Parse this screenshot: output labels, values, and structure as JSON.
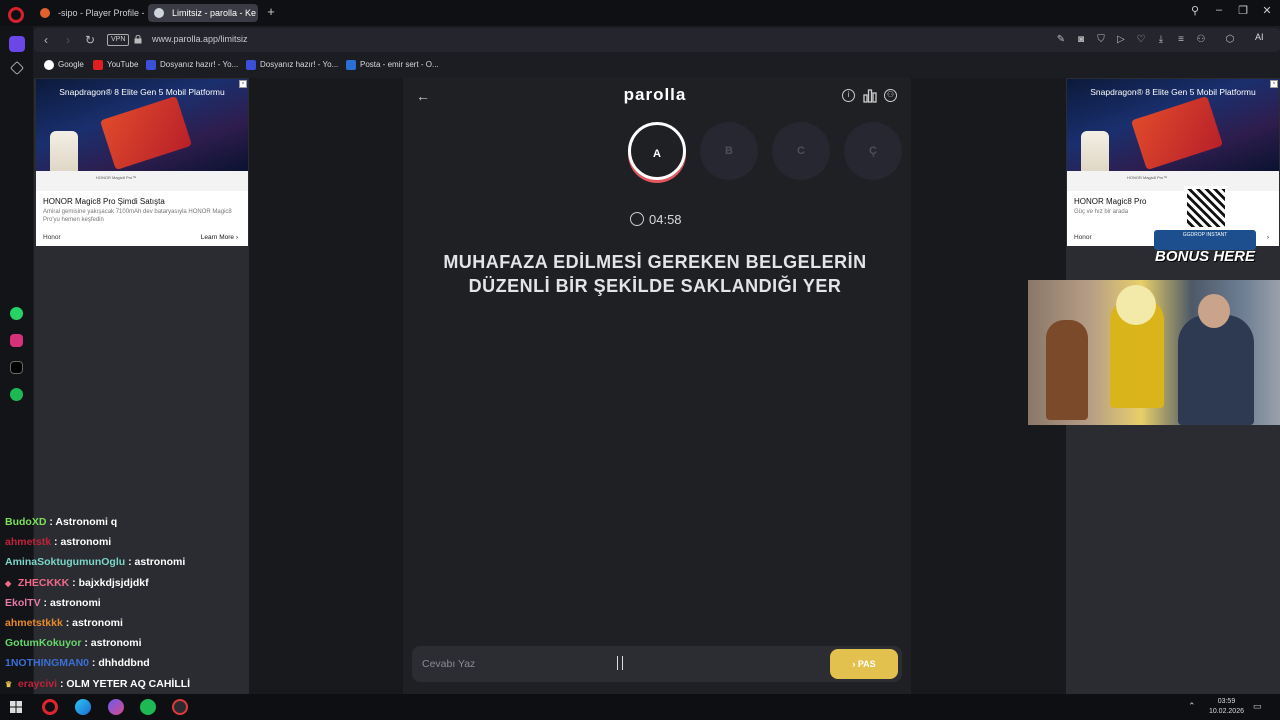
{
  "browser": {
    "tabs": [
      {
        "label": "-sipo - Player Profile - FAC"
      },
      {
        "label": "Limitsiz - parolla - Ke"
      }
    ],
    "vpn_label": "VPN",
    "url": "www.parolla.app/limitsiz",
    "ai_label": "AI",
    "bookmarks": [
      {
        "label": "Google"
      },
      {
        "label": "YouTube"
      },
      {
        "label": "Dosyanız hazır! - Yo..."
      },
      {
        "label": "Dosyanız hazır! - Yo..."
      },
      {
        "label": "Posta - emir sert - O..."
      }
    ]
  },
  "ads": {
    "left": {
      "headline": "Snapdragon® 8 Elite Gen 5 Mobil Platformu",
      "product_strip": "HONOR Magic8 Pro™",
      "title": "HONOR Magic8 Pro Şimdi Satışta",
      "description": "Amiral gemisine yakışacak 7100mAh dev bataryasıyla HONOR Magic8 Pro'yu hemen keşfedin",
      "brand": "Honor",
      "cta": "Learn More"
    },
    "right": {
      "headline": "Snapdragon® 8 Elite Gen 5 Mobil Platformu",
      "product_strip": "HONOR Magic8 Pro™",
      "title": "HONOR Magic8 Pro",
      "description": "Güç ve hız bir arada",
      "brand": "Honor"
    }
  },
  "game": {
    "logo": "parolla",
    "letters": [
      {
        "letter": "A",
        "state": "active"
      },
      {
        "letter": "B",
        "state": "pending"
      },
      {
        "letter": "C",
        "state": "pending"
      },
      {
        "letter": "Ç",
        "state": "pending"
      }
    ],
    "timer": "04:58",
    "question": "MUHAFAZA EDİLMESİ GEREKEN BELGELERİN DÜZENLİ BİR ŞEKİLDE SAKLANDIĞI YER",
    "answer_placeholder": "Cevabı Yaz",
    "answer_value": "",
    "pass_label": "PAS"
  },
  "overlay": {
    "bonus_bar": "GGDROP INSTANT",
    "bonus_text": "BONUS HERE"
  },
  "chat": [
    {
      "user": "BudoXD",
      "text": "Astronomi q",
      "color": "#7be05a"
    },
    {
      "user": "ahmetstk",
      "text": "astronomi",
      "color": "#c0233a"
    },
    {
      "user": "AminaSoktugumunOglu",
      "text": "astronomi",
      "color": "#7ad6c8"
    },
    {
      "user": "ZHECKKK",
      "text": "bajxkdjsjdjdkf",
      "color": "#f06a8a"
    },
    {
      "user": "EkolTV",
      "text": "astronomi",
      "color": "#e57aa9"
    },
    {
      "user": "ahmetstkkk",
      "text": "astronomi",
      "color": "#e6892a"
    },
    {
      "user": "GotumKokuyor",
      "text": "astronomi",
      "color": "#65d86a"
    },
    {
      "user": "1NOTHINGMAN0",
      "text": "dhhddbnd",
      "color": "#3a6fd6"
    },
    {
      "user": "eraycivi",
      "text": "OLM YETER AQ CAHİLLİ",
      "color": "#c0233a"
    }
  ],
  "taskbar": {
    "time": "03:59",
    "date": "10.02.2026"
  },
  "colors": {
    "accent_pass": "#e2c14e",
    "active_letter_ring": "#e5565e",
    "page_bg": "#18191d"
  }
}
